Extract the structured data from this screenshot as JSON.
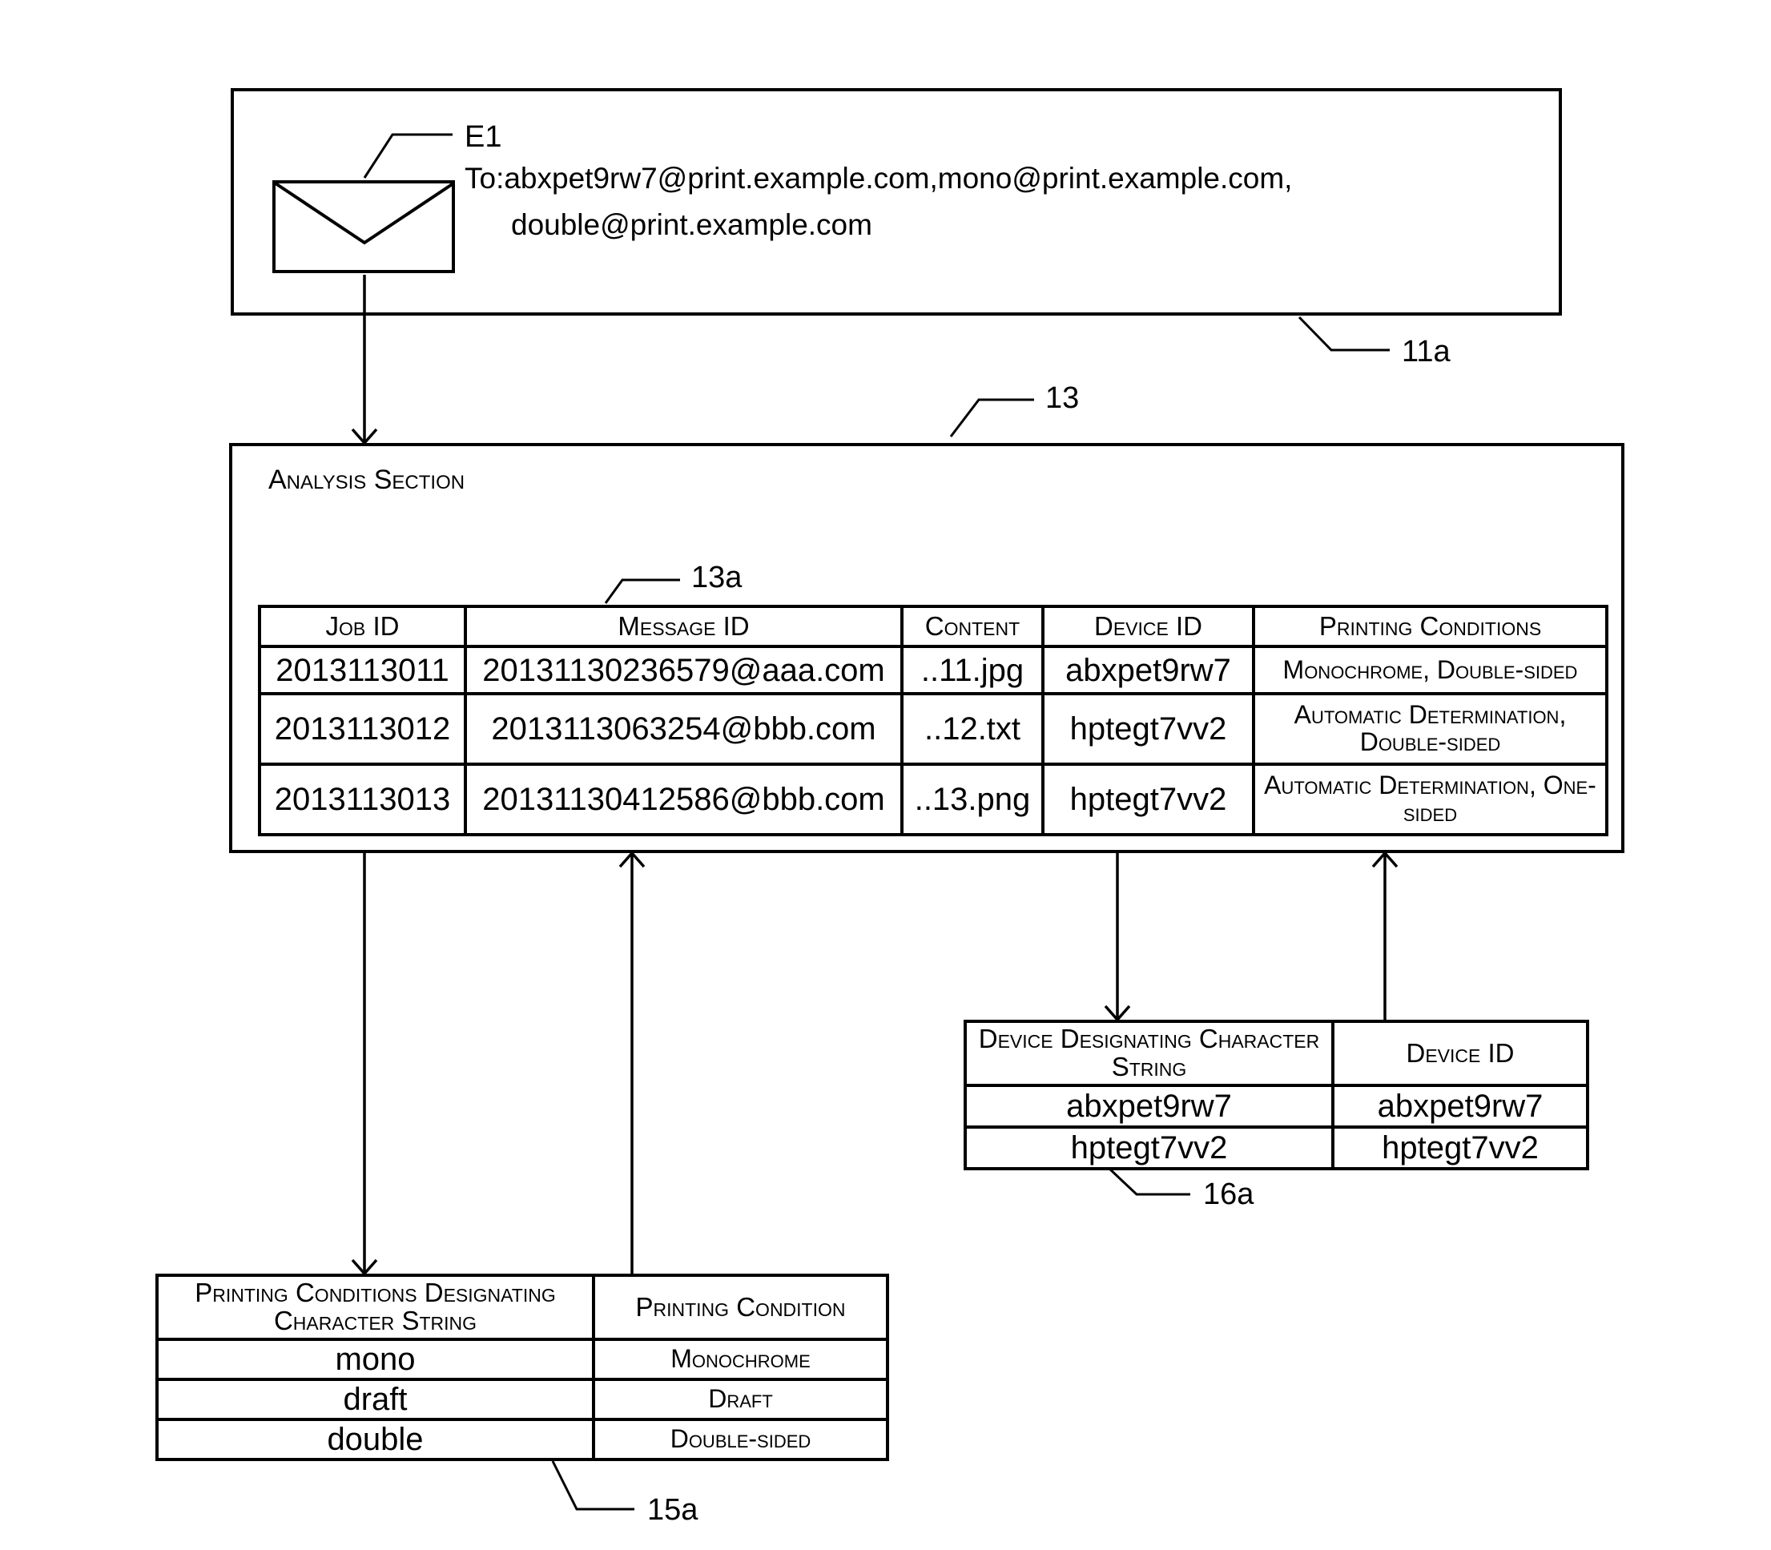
{
  "email_box": {
    "ref_label": "11a",
    "message_label": "E1",
    "to_line1": "To:abxpet9rw7@print.example.com,mono@print.example.com,",
    "to_line2": "double@print.example.com",
    "icon": "envelope-icon"
  },
  "analysis_section": {
    "ref_label": "13",
    "title": "Analysis Section",
    "job_table": {
      "ref_label": "13a",
      "columns": [
        "Job ID",
        "Message ID",
        "Content",
        "Device ID",
        "Printing Conditions"
      ],
      "rows": [
        [
          "2013113011",
          "20131130236579@aaa.com",
          "..11.jpg",
          "abxpet9rw7",
          "Monochrome, Double-sided"
        ],
        [
          "2013113012",
          "2013113063254@bbb.com",
          "..12.txt",
          "hptegt7vv2",
          "Automatic Determination, Double-sided"
        ],
        [
          "2013113013",
          "20131130412586@bbb.com",
          "..13.png",
          "hptegt7vv2",
          "Automatic Determination, One-sided"
        ]
      ]
    }
  },
  "device_table": {
    "ref_label": "16a",
    "columns": [
      "Device Designating Character String",
      "Device ID"
    ],
    "rows": [
      [
        "abxpet9rw7",
        "abxpet9rw7"
      ],
      [
        "hptegt7vv2",
        "hptegt7vv2"
      ]
    ]
  },
  "printing_conditions_table": {
    "ref_label": "15a",
    "columns": [
      "Printing Conditions Designating Character String",
      "Printing Condition"
    ],
    "rows": [
      [
        "mono",
        "Monochrome"
      ],
      [
        "draft",
        "Draft"
      ],
      [
        "double",
        "Double-sided"
      ]
    ]
  }
}
